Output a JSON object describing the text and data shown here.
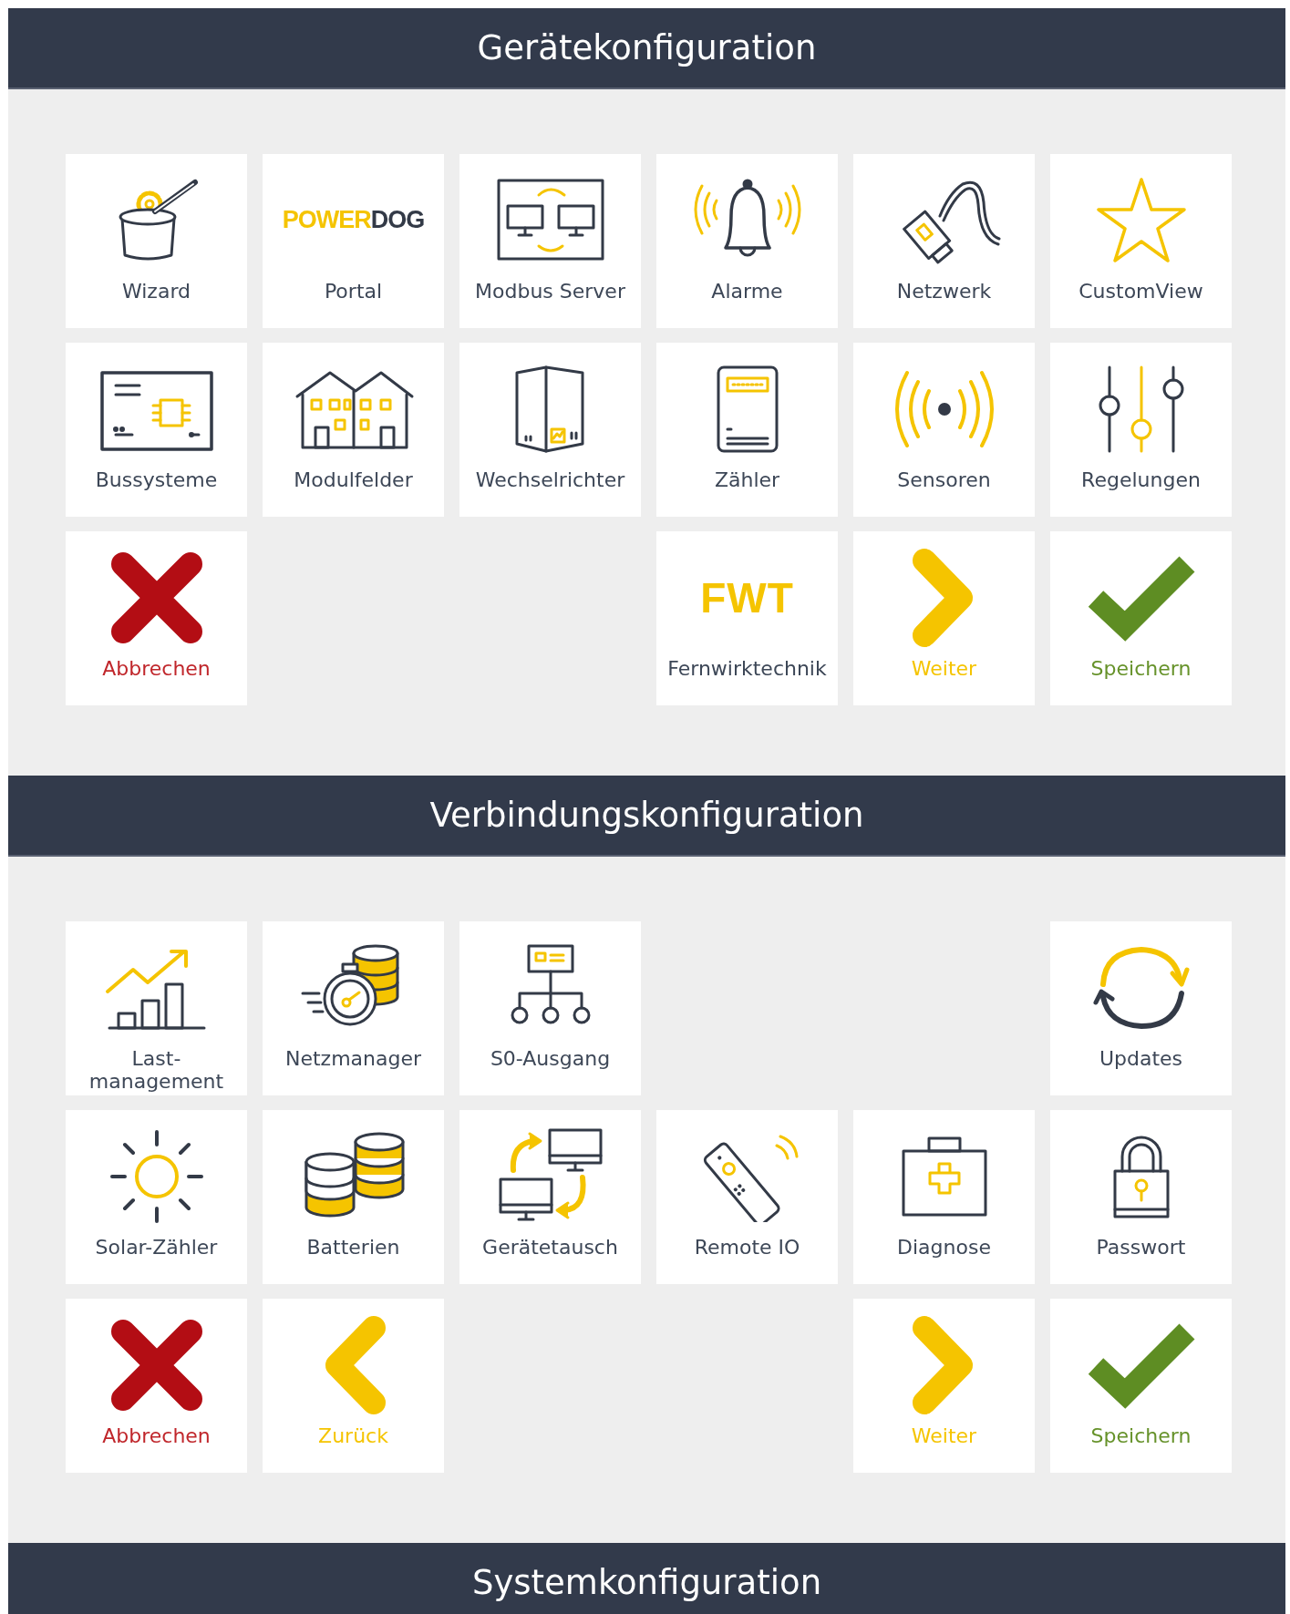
{
  "sections": [
    {
      "title": "Gerätekonfiguration",
      "rows": [
        [
          {
            "kind": "wizard",
            "label": "Wizard"
          },
          {
            "kind": "portal",
            "label": "Portal",
            "logo_parts": [
              "POWER",
              "DOG"
            ]
          },
          {
            "kind": "modbus",
            "label": "Modbus Server"
          },
          {
            "kind": "alarm",
            "label": "Alarme"
          },
          {
            "kind": "network",
            "label": "Netzwerk"
          },
          {
            "kind": "star",
            "label": "CustomView"
          }
        ],
        [
          {
            "kind": "bus",
            "label": "Bussysteme"
          },
          {
            "kind": "houses",
            "label": "Modulfelder"
          },
          {
            "kind": "inverter",
            "label": "Wechselrichter"
          },
          {
            "kind": "meter",
            "label": "Zähler"
          },
          {
            "kind": "sensor",
            "label": "Sensoren"
          },
          {
            "kind": "sliders",
            "label": "Regelungen"
          }
        ],
        [
          {
            "kind": "cancel",
            "label": "Abbrechen"
          },
          {
            "kind": "empty"
          },
          {
            "kind": "empty"
          },
          {
            "kind": "fwt",
            "label": "Fernwirktechnik",
            "logo_parts": [
              "FWT"
            ]
          },
          {
            "kind": "next",
            "label": "Weiter"
          },
          {
            "kind": "save",
            "label": "Speichern"
          }
        ]
      ]
    },
    {
      "title": "Verbindungskonfiguration",
      "rows": [
        [
          {
            "kind": "chart",
            "label": "Last-management"
          },
          {
            "kind": "netzmanager",
            "label": "Netzmanager"
          },
          {
            "kind": "tree",
            "label": "S0-Ausgang"
          },
          {
            "kind": "empty"
          },
          {
            "kind": "empty"
          },
          {
            "kind": "updates",
            "label": "Updates"
          }
        ],
        [
          {
            "kind": "sun",
            "label": "Solar-Zähler"
          },
          {
            "kind": "batteries",
            "label": "Batterien"
          },
          {
            "kind": "swap",
            "label": "Gerätetausch"
          },
          {
            "kind": "remote",
            "label": "Remote IO"
          },
          {
            "kind": "kit",
            "label": "Diagnose"
          },
          {
            "kind": "lock",
            "label": "Passwort"
          }
        ],
        [
          {
            "kind": "cancel",
            "label": "Abbrechen"
          },
          {
            "kind": "back",
            "label": "Zurück"
          },
          {
            "kind": "empty"
          },
          {
            "kind": "empty"
          },
          {
            "kind": "next",
            "label": "Weiter"
          },
          {
            "kind": "save",
            "label": "Speichern"
          }
        ]
      ]
    },
    {
      "title": "Systemkonfiguration"
    }
  ]
}
